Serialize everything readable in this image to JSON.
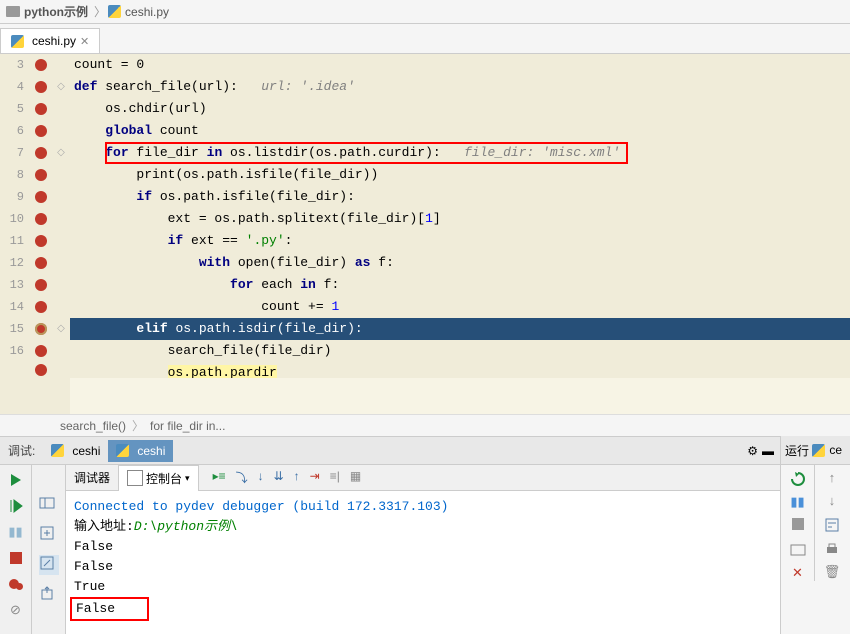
{
  "breadcrumb": {
    "folder": "python示例",
    "file": "ceshi.py"
  },
  "tab": {
    "name": "ceshi.py"
  },
  "lines": {
    "start": 3
  },
  "code": {
    "l3": "count = 0",
    "l4_def": "def",
    "l4_fn": "search_file",
    "l4_rest": "(url):",
    "l4_cmt": "url: '.idea'",
    "l5": "os.chdir(url)",
    "l6_kw": "global",
    "l6_rest": " count",
    "l7_for": "for",
    "l7_mid": " file_dir ",
    "l7_in": "in",
    "l7_rest": " os.listdir(os.path.curdir):",
    "l7_cmt": "file_dir: 'misc.xml'",
    "l8_a": "print",
    "l8_b": "(os.path.isfile(file_dir))",
    "l9_if": "if",
    "l9_rest": " os.path.isfile(file_dir):",
    "l10_a": "ext = os.path.splitext(file_dir)[",
    "l10_n": "1",
    "l10_b": "]",
    "l11_if": "if",
    "l11_a": " ext == ",
    "l11_s": "'.py'",
    "l11_b": ":",
    "l12_with": "with",
    "l12_a": " open(file_dir) ",
    "l12_as": "as",
    "l12_b": " f:",
    "l13_for": "for",
    "l13_a": " each ",
    "l13_in": "in",
    "l13_b": " f:",
    "l14_a": "count += ",
    "l14_n": "1",
    "l15_elif": "elif",
    "l15_rest": " os.path.isdir(file_dir):",
    "l16": "search_file(file_dir)",
    "l17": "os.path.pardir"
  },
  "navpath": {
    "a": "search_file()",
    "b": "for file_dir in..."
  },
  "dbg": {
    "label": "调试:",
    "tab1": "ceshi",
    "tab2": "ceshi"
  },
  "run": {
    "label": "运行",
    "cfg": "ce"
  },
  "console": {
    "tab1": "调试器",
    "tab2": "控制台",
    "line1a": "Connected to pydev debugger (build ",
    "line1b": "172.3317.103",
    "line1c": ")",
    "line2a": "输入地址:",
    "line2b": "D:\\python示例\\",
    "o1": "False",
    "o2": "False",
    "o3": "True",
    "o4": "False"
  }
}
